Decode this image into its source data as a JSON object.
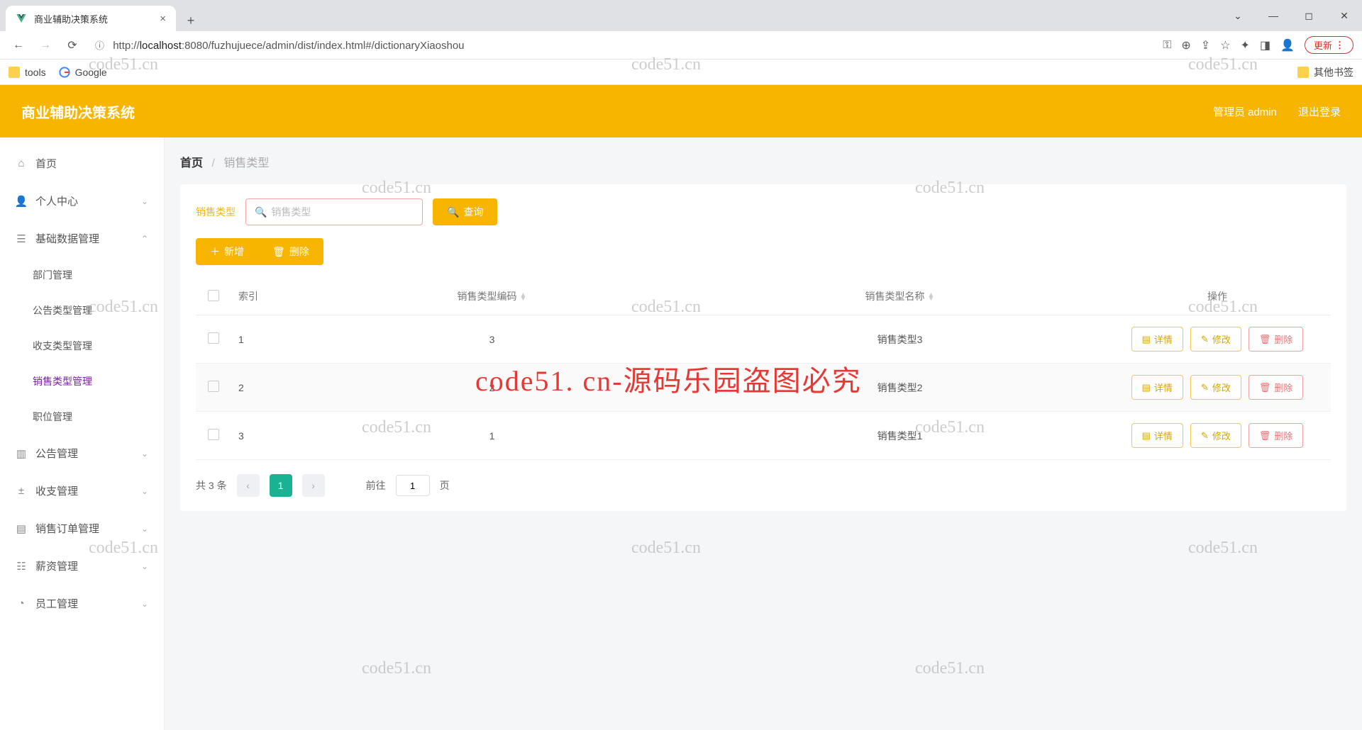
{
  "browser": {
    "tab_title": "商业辅助决策系统",
    "url_prefix": "http://",
    "url_host": "localhost",
    "url_rest": ":8080/fuzhujuece/admin/dist/index.html#/dictionaryXiaoshou",
    "update_label": "更新",
    "bookmarks": {
      "tools": "tools",
      "google": "Google",
      "other": "其他书签"
    }
  },
  "header": {
    "title": "商业辅助决策系统",
    "user": "管理员 admin",
    "logout": "退出登录"
  },
  "sidebar": {
    "home": "首页",
    "personal": "个人中心",
    "basic": "基础数据管理",
    "basic_children": {
      "dept": "部门管理",
      "notice_type": "公告类型管理",
      "inout_type": "收支类型管理",
      "sales_type": "销售类型管理",
      "position": "职位管理"
    },
    "notice": "公告管理",
    "inout": "收支管理",
    "order": "销售订单管理",
    "salary": "薪资管理",
    "staff": "员工管理"
  },
  "breadcrumb": {
    "home": "首页",
    "current": "销售类型"
  },
  "search": {
    "label": "销售类型",
    "placeholder": "销售类型",
    "query_btn": "查询"
  },
  "actions": {
    "add": "新增",
    "delete": "删除"
  },
  "table": {
    "headers": {
      "index": "索引",
      "code": "销售类型编码",
      "name": "销售类型名称",
      "ops": "操作"
    },
    "rows": [
      {
        "index": "1",
        "code": "3",
        "name": "销售类型3"
      },
      {
        "index": "2",
        "code": "2",
        "name": "销售类型2"
      },
      {
        "index": "3",
        "code": "1",
        "name": "销售类型1"
      }
    ],
    "op_labels": {
      "detail": "详情",
      "edit": "修改",
      "delete": "删除"
    }
  },
  "pagination": {
    "total": "共 3 条",
    "current": "1",
    "goto_prefix": "前往",
    "goto_suffix": "页",
    "goto_value": "1"
  },
  "watermark": "code51.cn",
  "watermark_red": "code51. cn-源码乐园盗图必究"
}
